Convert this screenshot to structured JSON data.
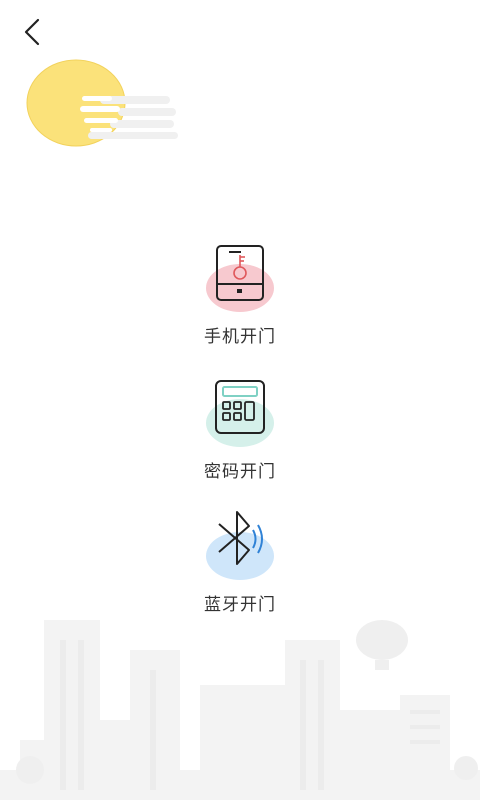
{
  "header": {
    "back_icon": "chevron-left-icon"
  },
  "options": [
    {
      "label": "手机开门",
      "icon": "phone-key-icon",
      "accent": "#f7c9cf"
    },
    {
      "label": "密码开门",
      "icon": "keypad-icon",
      "accent": "#d5f0ea"
    },
    {
      "label": "蓝牙开门",
      "icon": "bluetooth-icon",
      "accent": "#cfe6fa"
    }
  ],
  "colors": {
    "sun": "#fbe27a",
    "line": "#222222",
    "key": "#e0585c",
    "keypad_screen": "#7fd1c4",
    "bt_waves": "#2f82d6"
  }
}
